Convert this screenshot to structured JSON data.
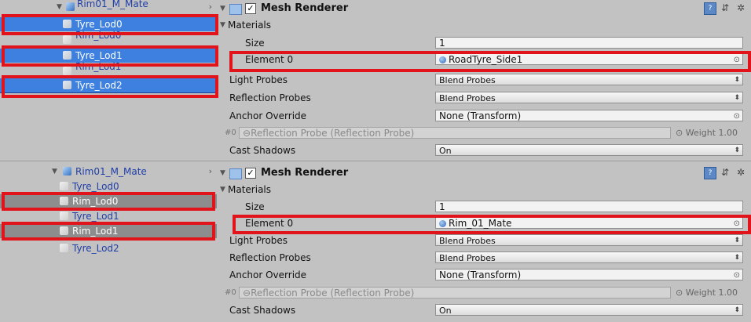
{
  "top": {
    "hierarchy": {
      "parent": "Rim01_M_Mate",
      "rows": [
        {
          "label": "Tyre_Lod0",
          "state": "selected"
        },
        {
          "label": "Rim_Lod0",
          "state": "normal"
        },
        {
          "label": "Tyre_Lod1",
          "state": "selected"
        },
        {
          "label": "Rim_Lod1",
          "state": "normal"
        },
        {
          "label": "Tyre_Lod2",
          "state": "selected"
        }
      ]
    },
    "inspector": {
      "component": "Mesh Renderer",
      "materials_label": "Materials",
      "size_label": "Size",
      "size_value": "1",
      "element_label": "Element 0",
      "element_value": "RoadTyre_Side1",
      "light_probes_label": "Light Probes",
      "light_probes_value": "Blend Probes",
      "reflection_probes_label": "Reflection Probes",
      "reflection_probes_value": "Blend Probes",
      "anchor_override_label": "Anchor Override",
      "anchor_override_value": "None (Transform)",
      "probe_prefix": "#0",
      "probe_text": "Reflection Probe (Reflection Probe)",
      "weight_text": "Weight 1.00",
      "cast_shadows_label": "Cast Shadows",
      "cast_shadows_value": "On"
    }
  },
  "bottom": {
    "hierarchy": {
      "parent": "Rim01_M_Mate",
      "rows": [
        {
          "label": "Tyre_Lod0",
          "state": "normal"
        },
        {
          "label": "Rim_Lod0",
          "state": "selected"
        },
        {
          "label": "Tyre_Lod1",
          "state": "normal"
        },
        {
          "label": "Rim_Lod1",
          "state": "selected"
        },
        {
          "label": "Tyre_Lod2",
          "state": "normal"
        }
      ]
    },
    "inspector": {
      "component": "Mesh Renderer",
      "materials_label": "Materials",
      "size_label": "Size",
      "size_value": "1",
      "element_label": "Element 0",
      "element_value": "Rim_01_Mate",
      "light_probes_label": "Light Probes",
      "light_probes_value": "Blend Probes",
      "reflection_probes_label": "Reflection Probes",
      "reflection_probes_value": "Blend Probes",
      "anchor_override_label": "Anchor Override",
      "anchor_override_value": "None (Transform)",
      "probe_prefix": "#0",
      "probe_text": "Reflection Probe (Reflection Probe)",
      "weight_text": "Weight 1.00",
      "cast_shadows_label": "Cast Shadows",
      "cast_shadows_value": "On"
    }
  },
  "colors": {
    "selection_blue": "#3d80df",
    "selection_gray": "#8d8d8d",
    "highlight_red": "#e0141a",
    "panel_bg": "#c2c2c2"
  },
  "icons": [
    "cube-icon",
    "fold-arrow-icon",
    "collapse-arrow-icon",
    "mesh-renderer-icon",
    "checkbox-icon",
    "book-icon",
    "settings-icon",
    "gear-icon",
    "object-picker-icon",
    "material-ball-icon"
  ]
}
